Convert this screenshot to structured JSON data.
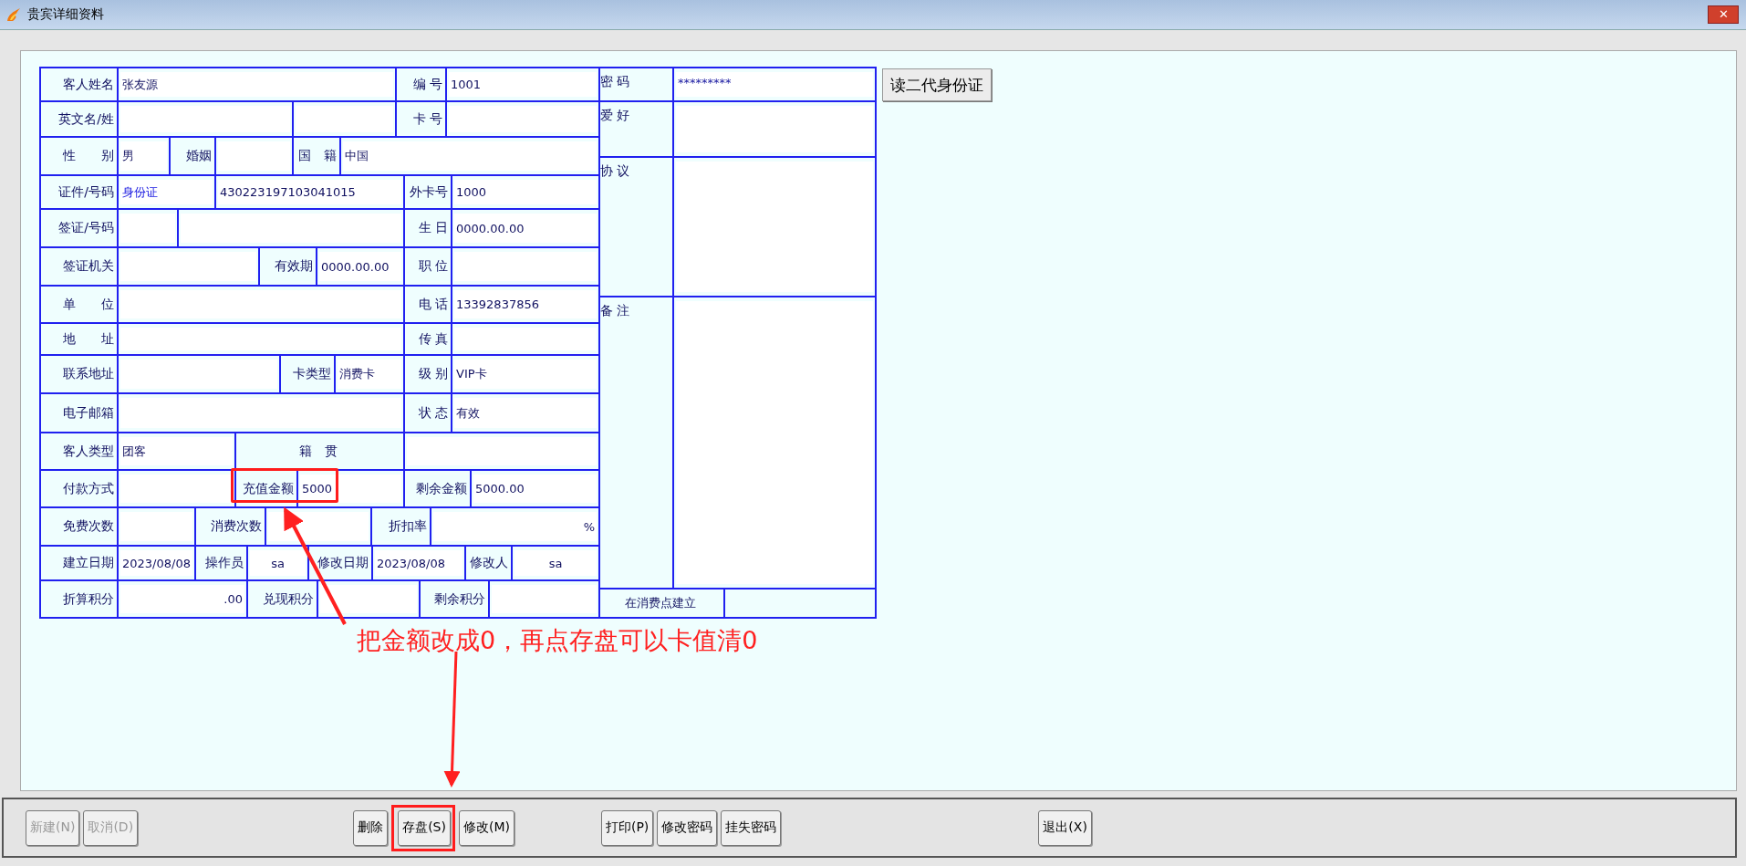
{
  "window": {
    "title": "贵宾详细资料",
    "close": "✕"
  },
  "form": {
    "rows": [
      [
        {
          "kind": "label",
          "text": "客人姓名"
        },
        {
          "kind": "value",
          "text": "张友源"
        },
        {
          "kind": "label",
          "text": "编 号"
        },
        {
          "kind": "value",
          "text": "1001"
        }
      ],
      [
        {
          "kind": "label",
          "text": "英文名/姓"
        },
        {
          "kind": "value"
        },
        {
          "kind": "value"
        },
        {
          "kind": "label",
          "text": "卡 号"
        },
        {
          "kind": "value"
        }
      ],
      [
        {
          "kind": "label",
          "text": "性　　别"
        },
        {
          "kind": "value",
          "text": "男"
        },
        {
          "kind": "label",
          "text": "婚姻"
        },
        {
          "kind": "value"
        },
        {
          "kind": "label",
          "text": "国　籍"
        },
        {
          "kind": "value",
          "text": "中国"
        }
      ],
      [
        {
          "kind": "label",
          "text": "证件/号码"
        },
        {
          "kind": "select",
          "text": "身份证"
        },
        {
          "kind": "value",
          "text": "430223197103041015"
        },
        {
          "kind": "label",
          "text": "外卡号"
        },
        {
          "kind": "value",
          "text": "1000"
        }
      ],
      [
        {
          "kind": "label",
          "text": "签证/号码"
        },
        {
          "kind": "value"
        },
        {
          "kind": "value"
        },
        {
          "kind": "label",
          "text": "生 日"
        },
        {
          "kind": "value",
          "text": "0000.00.00"
        }
      ],
      [
        {
          "kind": "label",
          "text": "签证机关"
        },
        {
          "kind": "value"
        },
        {
          "kind": "label",
          "text": "有效期"
        },
        {
          "kind": "value",
          "text": "0000.00.00"
        },
        {
          "kind": "label",
          "text": "职 位"
        },
        {
          "kind": "value"
        }
      ],
      [
        {
          "kind": "label",
          "text": "单　　位"
        },
        {
          "kind": "value"
        },
        {
          "kind": "label",
          "text": "电 话"
        },
        {
          "kind": "value",
          "text": "13392837856"
        }
      ],
      [
        {
          "kind": "label",
          "text": "地　　址"
        },
        {
          "kind": "value"
        },
        {
          "kind": "label",
          "text": "传 真"
        },
        {
          "kind": "value"
        }
      ],
      [
        {
          "kind": "label",
          "text": "联系地址"
        },
        {
          "kind": "value"
        },
        {
          "kind": "label",
          "text": "卡类型"
        },
        {
          "kind": "value",
          "text": "消费卡"
        },
        {
          "kind": "label",
          "text": "级 别"
        },
        {
          "kind": "value",
          "text": "VIP卡"
        }
      ],
      [
        {
          "kind": "label",
          "text": "电子邮箱"
        },
        {
          "kind": "value"
        },
        {
          "kind": "label",
          "text": "状 态"
        },
        {
          "kind": "value",
          "text": "有效"
        }
      ],
      [
        {
          "kind": "label",
          "text": "客人类型"
        },
        {
          "kind": "value",
          "text": "团客"
        },
        {
          "kind": "label",
          "text": "籍　贯"
        },
        {
          "kind": "value"
        }
      ],
      [
        {
          "kind": "label",
          "text": "付款方式"
        },
        {
          "kind": "value"
        },
        {
          "kind": "label",
          "text": "充值金额"
        },
        {
          "kind": "value",
          "text": "5000"
        },
        {
          "kind": "label",
          "text": "剩余金额"
        },
        {
          "kind": "value",
          "text": "5000.00"
        }
      ],
      [
        {
          "kind": "label",
          "text": "免费次数"
        },
        {
          "kind": "value"
        },
        {
          "kind": "label",
          "text": "消费次数"
        },
        {
          "kind": "value"
        },
        {
          "kind": "label",
          "text": "折扣率"
        },
        {
          "kind": "value",
          "text": "%"
        }
      ],
      [
        {
          "kind": "label",
          "text": "建立日期"
        },
        {
          "kind": "value",
          "text": "2023/08/08"
        },
        {
          "kind": "label",
          "text": "操作员"
        },
        {
          "kind": "value",
          "text": "sa"
        },
        {
          "kind": "label",
          "text": "修改日期"
        },
        {
          "kind": "value",
          "text": "2023/08/08"
        },
        {
          "kind": "label",
          "text": "修改人"
        },
        {
          "kind": "value",
          "text": "sa"
        }
      ],
      [
        {
          "kind": "label",
          "text": "折算积分"
        },
        {
          "kind": "value",
          "text": ".00"
        },
        {
          "kind": "label",
          "text": "兑现积分"
        },
        {
          "kind": "value"
        },
        {
          "kind": "label",
          "text": "剩余积分"
        },
        {
          "kind": "value"
        }
      ]
    ],
    "side": [
      {
        "label": "密 码",
        "value": "*********"
      },
      {
        "label": "爱 好"
      },
      {
        "label": "协 议"
      },
      {
        "label": "备 注"
      },
      {
        "label": "在消费点建立"
      }
    ]
  },
  "id_button": "读二代身份证",
  "toolbar": [
    {
      "label": "新建(N)",
      "disabled": true
    },
    {
      "label": "取消(D)",
      "disabled": true
    },
    {
      "label": "删除",
      "disabled": false
    },
    {
      "label": "存盘(S)",
      "disabled": false
    },
    {
      "label": "修改(M)",
      "disabled": false
    },
    {
      "label": "打印(P)",
      "disabled": false
    },
    {
      "label": "修改密码",
      "disabled": false
    },
    {
      "label": "挂失密码",
      "disabled": false
    },
    {
      "label": "退出(X)",
      "disabled": false
    }
  ],
  "annotation": {
    "text": "把金额改成0，再点存盘可以卡值清0"
  }
}
